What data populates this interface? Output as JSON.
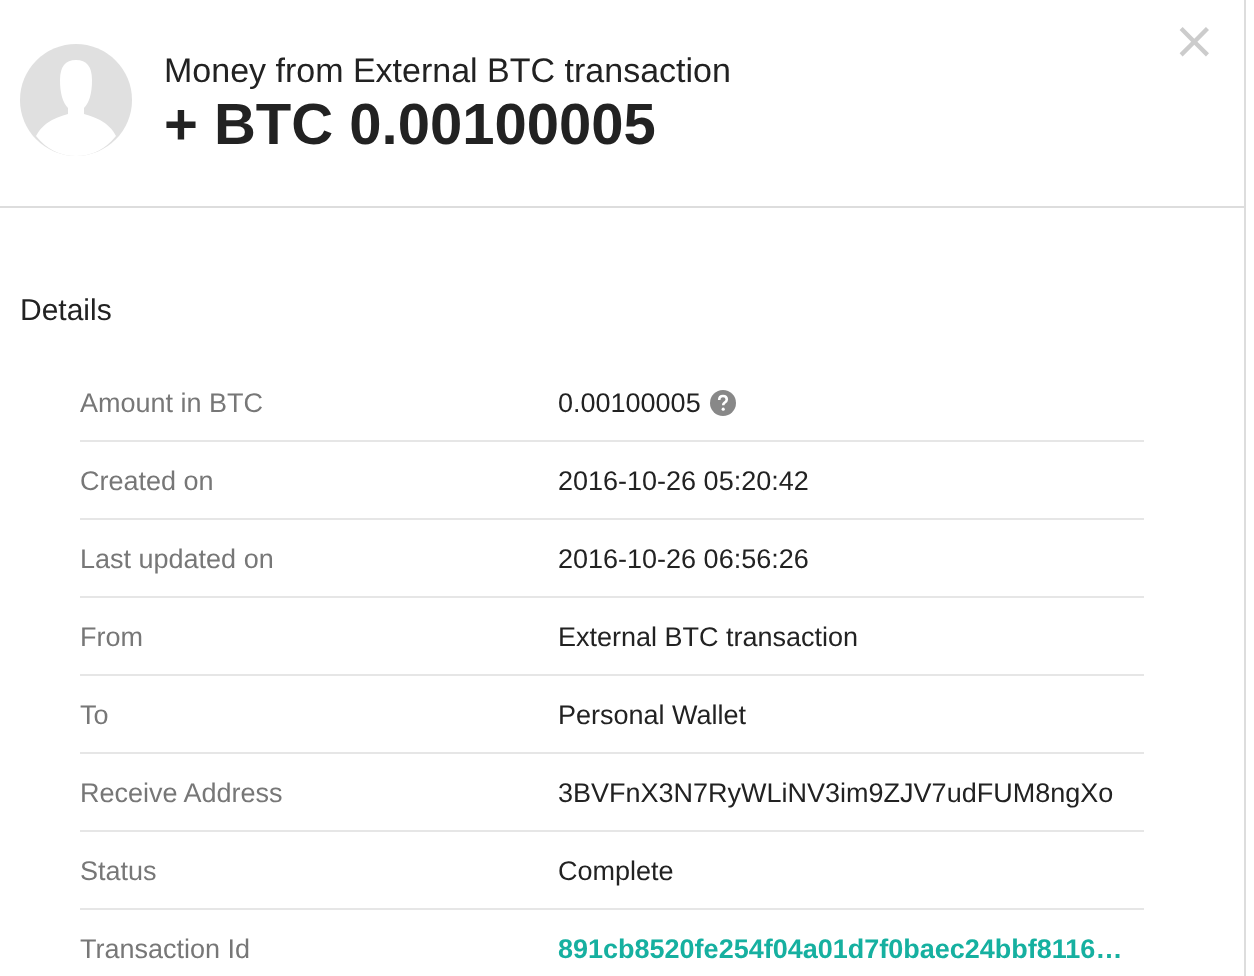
{
  "header": {
    "title": "Money from External BTC transaction",
    "amount": "+ BTC 0.00100005",
    "close": "×"
  },
  "section_title": "Details",
  "rows": [
    {
      "label": "Amount in BTC",
      "value": "0.00100005",
      "kind": "help"
    },
    {
      "label": "Created on",
      "value": "2016-10-26 05:20:42",
      "kind": "text"
    },
    {
      "label": "Last updated on",
      "value": "2016-10-26 06:56:26",
      "kind": "text"
    },
    {
      "label": "From",
      "value": "External BTC transaction",
      "kind": "text"
    },
    {
      "label": "To",
      "value": "Personal Wallet",
      "kind": "text"
    },
    {
      "label": "Receive Address",
      "value": "3BVFnX3N7RyWLiNV3im9ZJV7udFUM8ngXo",
      "kind": "text"
    },
    {
      "label": "Status",
      "value": "Complete",
      "kind": "text"
    },
    {
      "label": "Transaction Id",
      "value": "891cb8520fe254f04a01d7f0baec24bbf8116…",
      "kind": "link"
    }
  ]
}
